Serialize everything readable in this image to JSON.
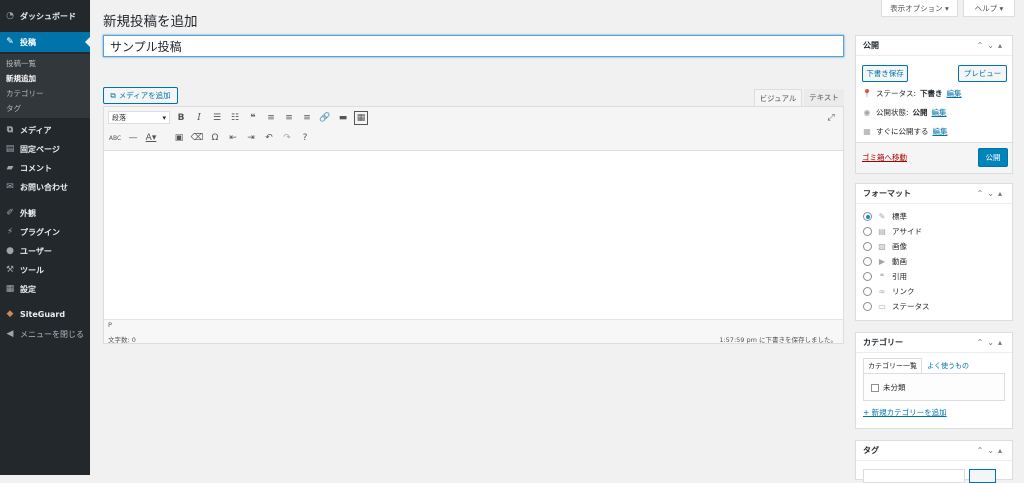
{
  "sidebar": {
    "dashboard": "ダッシュボード",
    "posts": "投稿",
    "sub": [
      "投稿一覧",
      "新規追加",
      "カテゴリー",
      "タグ"
    ],
    "media": "メディア",
    "pages": "固定ページ",
    "comments": "コメント",
    "contact": "お問い合わせ",
    "appearance": "外観",
    "plugins": "プラグイン",
    "users": "ユーザー",
    "tools": "ツール",
    "settings": "設定",
    "siteguard": "SiteGuard",
    "collapse": "メニューを閉じる"
  },
  "header": {
    "title": "新規投稿を追加",
    "screen_options": "表示オプション ▾",
    "help": "ヘルプ ▾"
  },
  "post": {
    "title_value": "サンプル投稿"
  },
  "editor": {
    "add_media": "メディアを追加",
    "tab_visual": "ビジュアル",
    "tab_text": "テキスト",
    "format_select": "段落",
    "path": "P",
    "word_count": "文字数: 0",
    "autosave": "1:57:59 pm に下書きを保存しました。"
  },
  "publish": {
    "title": "公開",
    "save_draft": "下書き保存",
    "preview": "プレビュー",
    "status_label": "ステータス:",
    "status_value": "下書き",
    "visibility_label": "公開状態:",
    "visibility_value": "公開",
    "schedule_label": "すぐに公開する",
    "edit": "編集",
    "trash": "ゴミ箱へ移動",
    "publish_btn": "公開"
  },
  "format": {
    "title": "フォーマット",
    "options": [
      "標準",
      "アサイド",
      "画像",
      "動画",
      "引用",
      "リンク",
      "ステータス"
    ],
    "selected": 0
  },
  "categories": {
    "title": "カテゴリー",
    "tab_all": "カテゴリー一覧",
    "tab_popular": "よく使うもの",
    "items": [
      "未分類"
    ],
    "add_new": "+ 新規カテゴリーを追加"
  },
  "tags": {
    "title": "タグ"
  },
  "colors": {
    "accent": "#0073aa",
    "sidebar": "#23282d",
    "trash": "#a00"
  }
}
